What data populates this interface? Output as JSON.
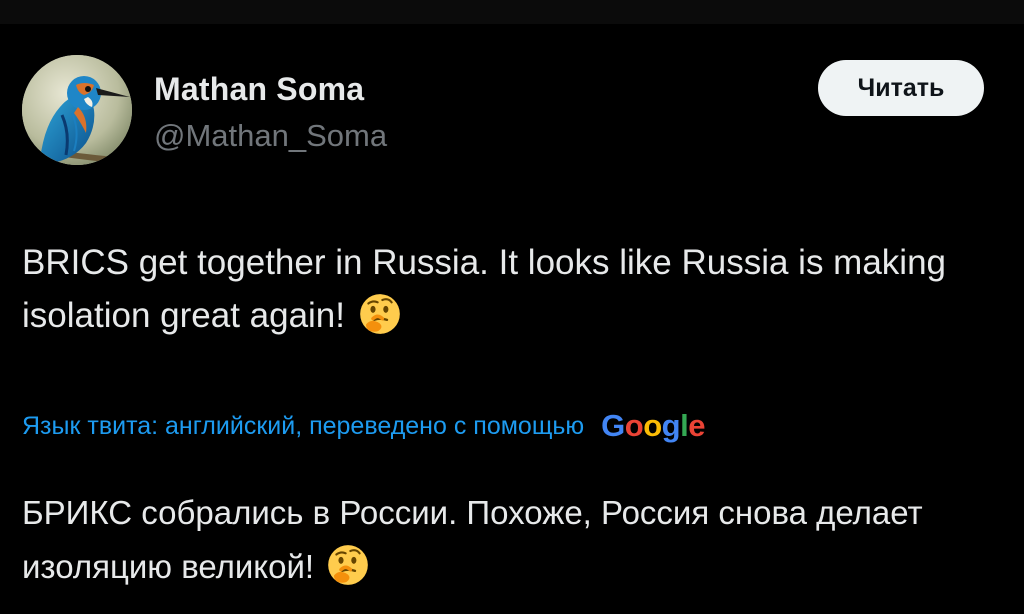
{
  "user": {
    "display_name": "Mathan Soma",
    "handle": "@Mathan_Soma"
  },
  "follow_button": {
    "label": "Читать"
  },
  "tweet": {
    "text": "BRICS get together in Russia. It looks like Russia is making isolation great again!",
    "emoji_icon": "thinking-face-icon"
  },
  "translation": {
    "note": "Язык твита: английский, переведено с помощью",
    "provider_letters": [
      "G",
      "o",
      "o",
      "g",
      "l",
      "e"
    ],
    "provider_colors": [
      "#4285F4",
      "#EA4335",
      "#FBBC05",
      "#4285F4",
      "#34A853",
      "#EA4335"
    ],
    "text": "БРИКС собрались в России. Похоже, Россия снова делает изоляцию великой!"
  },
  "colors": {
    "background": "#000000",
    "text": "#e7e9ea",
    "secondary_text": "#71767b",
    "link": "#1d9bf0",
    "button_bg": "#eff3f4"
  }
}
